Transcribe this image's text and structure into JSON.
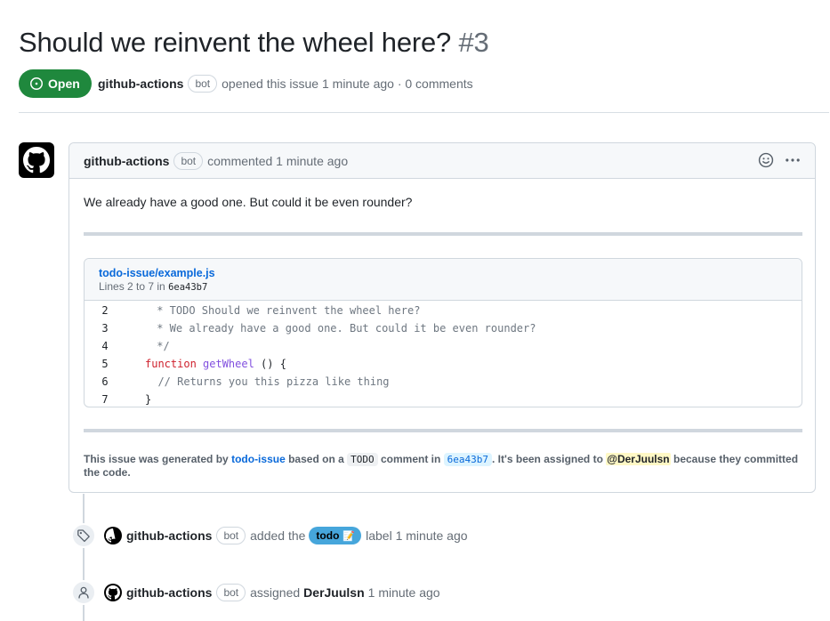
{
  "issue": {
    "title": "Should we reinvent the wheel here?",
    "number": "#3",
    "state": "Open",
    "author": "github-actions",
    "bot_badge": "bot",
    "opened_text": "opened this issue 1 minute ago · 0 comments"
  },
  "comment": {
    "author": "github-actions",
    "bot_badge": "bot",
    "time_text": "commented 1 minute ago",
    "body": "We already have a good one. But could it be even rounder?",
    "snippet": {
      "file": "todo-issue/example.js",
      "lines_prefix": "Lines 2 to 7 in",
      "sha": "6ea43b7",
      "lines": [
        {
          "n": "2",
          "text": " * TODO Should we reinvent the wheel here?"
        },
        {
          "n": "3",
          "text": " * We already have a good one. But could it be even rounder?"
        },
        {
          "n": "4",
          "text": " */"
        },
        {
          "n": "5",
          "kw": "function",
          "fn": "getWheel",
          "rest": " () {"
        },
        {
          "n": "6",
          "text": "  // Returns you this pizza like thing"
        },
        {
          "n": "7",
          "plain": "}"
        }
      ]
    },
    "note": {
      "t1": "This issue was generated by",
      "link1": "todo-issue",
      "t2": "based on a",
      "chip1": "TODO",
      "t3": "comment in",
      "chip2": "6ea43b7",
      "t4": ". It's been assigned to",
      "mention": "@DerJuulsn",
      "t5": "because they committed the code."
    }
  },
  "timeline": [
    {
      "author": "github-actions",
      "bot_badge": "bot",
      "action": "added the",
      "label": "todo",
      "label_emoji": "📝",
      "suffix": "label 1 minute ago"
    },
    {
      "author": "github-actions",
      "bot_badge": "bot",
      "action": "assigned",
      "assignee": "DerJuulsn",
      "suffix": "1 minute ago"
    }
  ],
  "colors": {
    "open_green": "#1f883d",
    "link_blue": "#0969da",
    "label_blue": "#46a6db",
    "mention_yellow": "#fff8c5"
  },
  "icons": [
    "issue-opened-icon",
    "github-mark-icon",
    "smiley-icon",
    "kebab-icon",
    "tag-icon",
    "person-icon"
  ]
}
